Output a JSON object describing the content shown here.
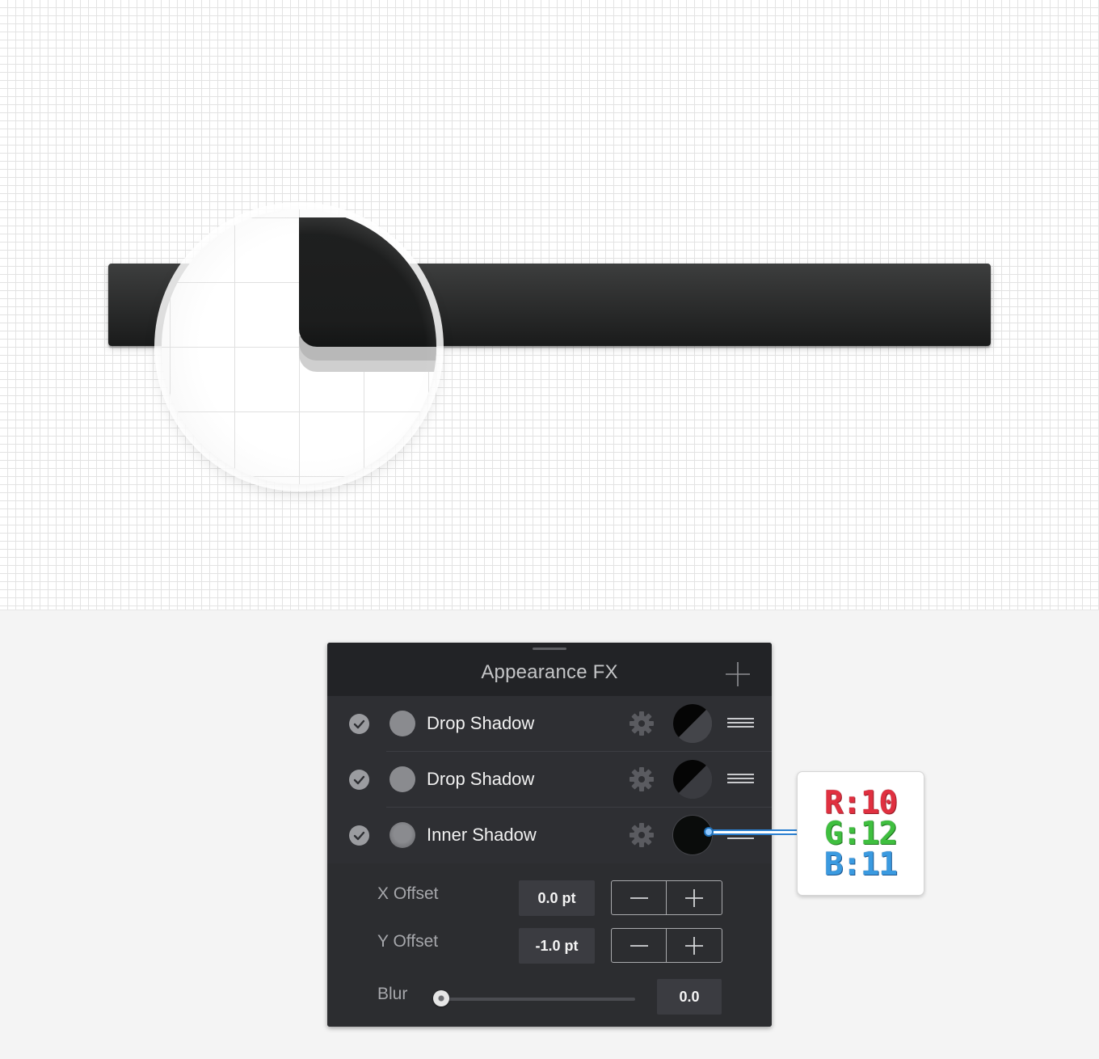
{
  "canvas": {
    "bar_color": "#2a2b2b",
    "grid_color": "#e3e3e3"
  },
  "panel": {
    "title": "Appearance FX",
    "add_icon": "plus-icon",
    "effects": [
      {
        "label": "Drop Shadow",
        "enabled": true,
        "swatch": "half-black-grey"
      },
      {
        "label": "Drop Shadow",
        "enabled": true,
        "swatch": "half-black-grey"
      },
      {
        "label": "Inner Shadow",
        "enabled": true,
        "swatch": "solid-black"
      }
    ],
    "settings": {
      "x_offset": {
        "label": "X Offset",
        "value": "0.0 pt"
      },
      "y_offset": {
        "label": "Y Offset",
        "value": "-1.0 pt"
      },
      "blur": {
        "label": "Blur",
        "value": "0.0",
        "level": 0
      }
    }
  },
  "callout": {
    "r": "R:10",
    "g": "G:12",
    "b": "B:11",
    "r_color": "#e03040",
    "g_color": "#3fbf3f",
    "b_color": "#3a9ae0"
  }
}
